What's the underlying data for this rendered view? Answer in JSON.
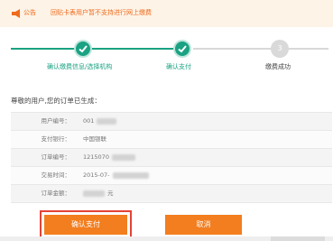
{
  "notice": {
    "tag": "公告",
    "text": "回贴卡表用户暂不支持进行网上缴费",
    "icon": "megaphone-icon"
  },
  "steps": [
    {
      "label": "确认缴费信息/选择机构",
      "state": "done"
    },
    {
      "label": "确认支付",
      "state": "done"
    },
    {
      "label": "缴费成功",
      "state": "todo",
      "number": "3"
    }
  ],
  "greeting": "尊敬的用户,您的订单已生成：",
  "order_info": {
    "rows": [
      {
        "label": "用户编号：",
        "value": "001"
      },
      {
        "label": "支付银行：",
        "value": "中国银联"
      },
      {
        "label": "订单编号：",
        "value": "1215070"
      },
      {
        "label": "交易时间：",
        "value": "2015-07-"
      },
      {
        "label": "订单金额：",
        "value": "元"
      }
    ]
  },
  "buttons": {
    "confirm": "确认支付",
    "cancel": "取消"
  },
  "colors": {
    "accent_green": "#1aa282",
    "accent_orange": "#f27e1f",
    "notice_text": "#ee6b1c",
    "highlight_red": "#e44236"
  }
}
